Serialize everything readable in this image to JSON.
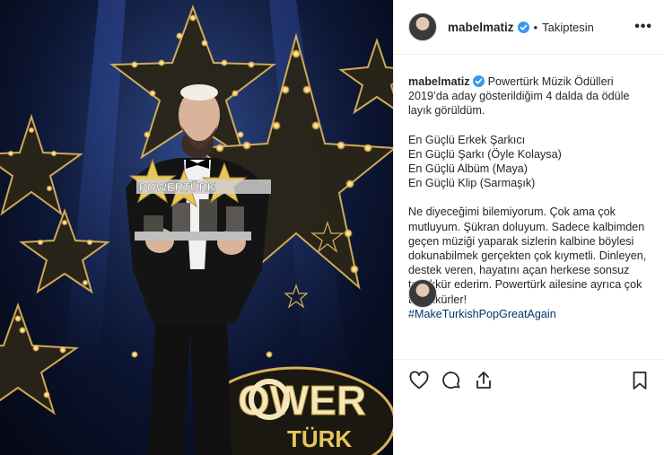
{
  "post": {
    "username": "mabelmatiz",
    "separator": "•",
    "follow_status": "Takiptesin",
    "more_label": "•••"
  },
  "caption": {
    "username": "mabelmatiz",
    "intro": "Powertürk Müzik Ödülleri 2019’da aday gösterildiğim 4 dalda da ödüle layık görüldüm.",
    "awards": [
      "En Güçlü Erkek Şarkıcı",
      "En Güçlü Şarkı (Öyle Kolaysa)",
      "En Güçlü Albüm (Maya)",
      "En Güçlü Klip (Sarmaşık)"
    ],
    "message_lines": [
      "Ne diyeceğimi bilemiyorum. Çok ama çok mutluyum. Şükran doluyum. Sadece kalbimden geçen müziği yaparak sizlerin kalbine böylesi dokunabilmek gerçekten çok kıymetli. Dinleyen, destek veren, hayatını açan herkese sonsuz teşekkür ederim. Powertürk ailesine ayrıca çok teşekkürler!"
    ],
    "hashtag": "#MakeTurkishPopGreatAgain"
  },
  "icons": {
    "verified": "verified-badge-icon",
    "like": "heart-icon",
    "comment": "comment-icon",
    "share": "share-icon",
    "save": "bookmark-icon"
  },
  "colors": {
    "verified_blue": "#3897f0",
    "hashtag": "#003569",
    "text": "#262626",
    "divider": "#efefef"
  }
}
